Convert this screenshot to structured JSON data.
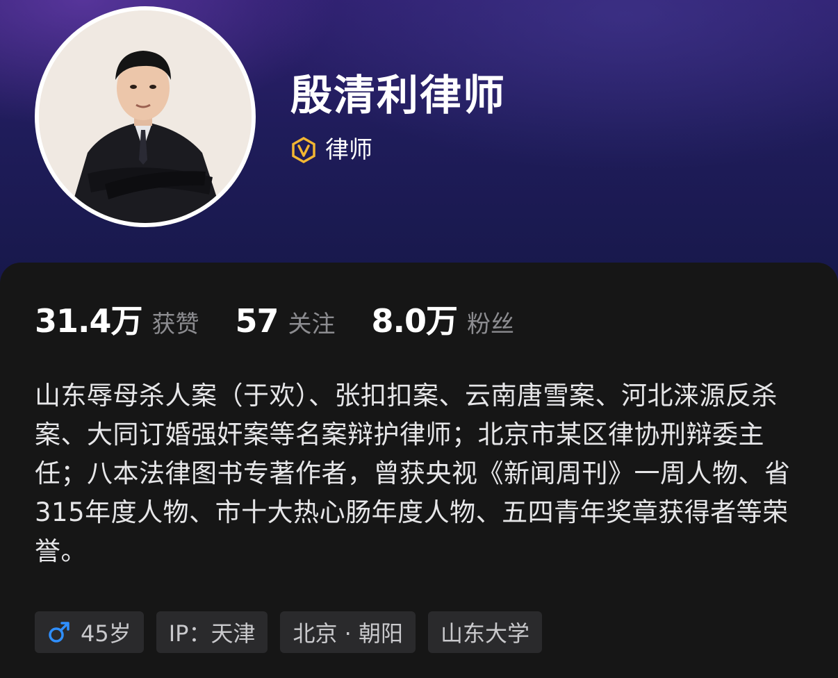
{
  "profile": {
    "name": "殷清利律师",
    "verified_label": "律师"
  },
  "stats": [
    {
      "value": "31.4万",
      "label": "获赞"
    },
    {
      "value": "57",
      "label": "关注"
    },
    {
      "value": "8.0万",
      "label": "粉丝"
    }
  ],
  "bio": "山东辱母杀人案（于欢）、张扣扣案、云南唐雪案、河北涞源反杀案、大同订婚强奸案等名案辩护律师；北京市某区律协刑辩委主任；八本法律图书专著作者，曾获央视《新闻周刊》一周人物、省315年度人物、市十大热心肠年度人物、五四青年奖章获得者等荣誉。",
  "tags": {
    "age": "45岁",
    "ip": "IP：天津",
    "location": "北京 · 朝阳",
    "school": "山东大学"
  },
  "icons": {
    "verified": "verified-v-badge-icon",
    "gender": "male-icon"
  },
  "colors": {
    "verified_badge": "#f2b632",
    "male_icon": "#2f8fff",
    "card_bg": "#161616",
    "tag_bg": "#2a2a2c"
  }
}
